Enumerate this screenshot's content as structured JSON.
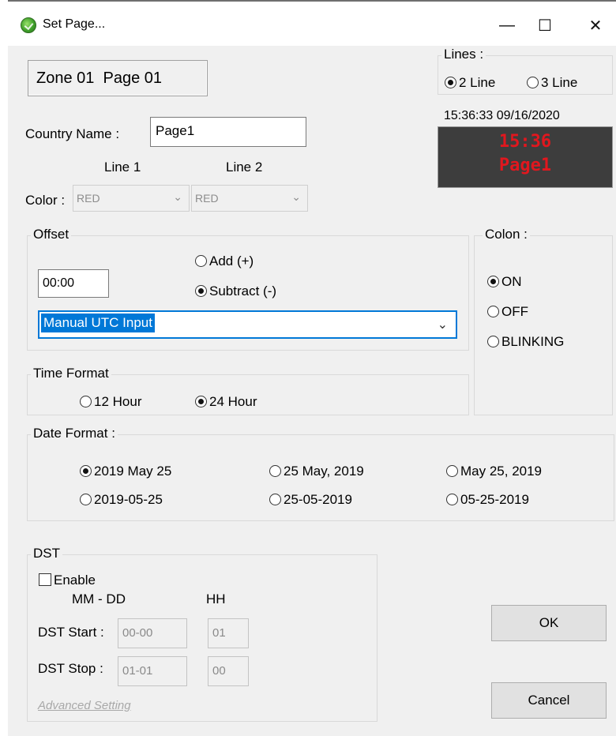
{
  "window": {
    "title": "Set Page...",
    "minimize_label": "—",
    "maximize_label": "☐",
    "close_label": "✕"
  },
  "zone": {
    "label": "Zone 01  Page 01"
  },
  "lines": {
    "legend": "Lines :",
    "options": [
      {
        "label": "2 Line",
        "selected": true
      },
      {
        "label": "3 Line",
        "selected": false
      }
    ]
  },
  "clock": {
    "datetime": "15:36:33  09/16/2020",
    "display_line1": "15:36",
    "display_line2": "Page1",
    "display_color": "#e1171e"
  },
  "country": {
    "label": "Country Name :",
    "value": "Page1"
  },
  "color": {
    "label": "Color :",
    "line1_header": "Line 1",
    "line2_header": "Line 2",
    "line1_value": "RED",
    "line2_value": "RED"
  },
  "offset": {
    "legend": "Offset",
    "time_value": "00:00",
    "add_label": "Add (+)",
    "subtract_label": "Subtract (-)",
    "selected": "subtract",
    "dropdown_value": "Manual UTC Input"
  },
  "colon": {
    "legend": "Colon :",
    "options": [
      {
        "label": "ON",
        "selected": true
      },
      {
        "label": "OFF",
        "selected": false
      },
      {
        "label": "BLINKING",
        "selected": false
      }
    ]
  },
  "time_format": {
    "legend": "Time Format",
    "options": [
      {
        "label": "12 Hour",
        "selected": false
      },
      {
        "label": "24 Hour",
        "selected": true
      }
    ]
  },
  "date_format": {
    "legend": "Date Format :",
    "options": [
      {
        "label": "2019 May 25",
        "selected": true
      },
      {
        "label": "25 May, 2019",
        "selected": false
      },
      {
        "label": "May 25, 2019",
        "selected": false
      },
      {
        "label": "2019-05-25",
        "selected": false
      },
      {
        "label": "25-05-2019",
        "selected": false
      },
      {
        "label": "05-25-2019",
        "selected": false
      }
    ]
  },
  "dst": {
    "legend": "DST",
    "enable_label": "Enable",
    "enabled": false,
    "col_mmdd": "MM - DD",
    "col_hh": "HH",
    "start_label": "DST Start :",
    "start_mmdd": "00-00",
    "start_hh": "01",
    "stop_label": "DST Stop :",
    "stop_mmdd": "01-01",
    "stop_hh": "00",
    "advanced_link": "Advanced Setting"
  },
  "buttons": {
    "ok": "OK",
    "cancel": "Cancel"
  }
}
